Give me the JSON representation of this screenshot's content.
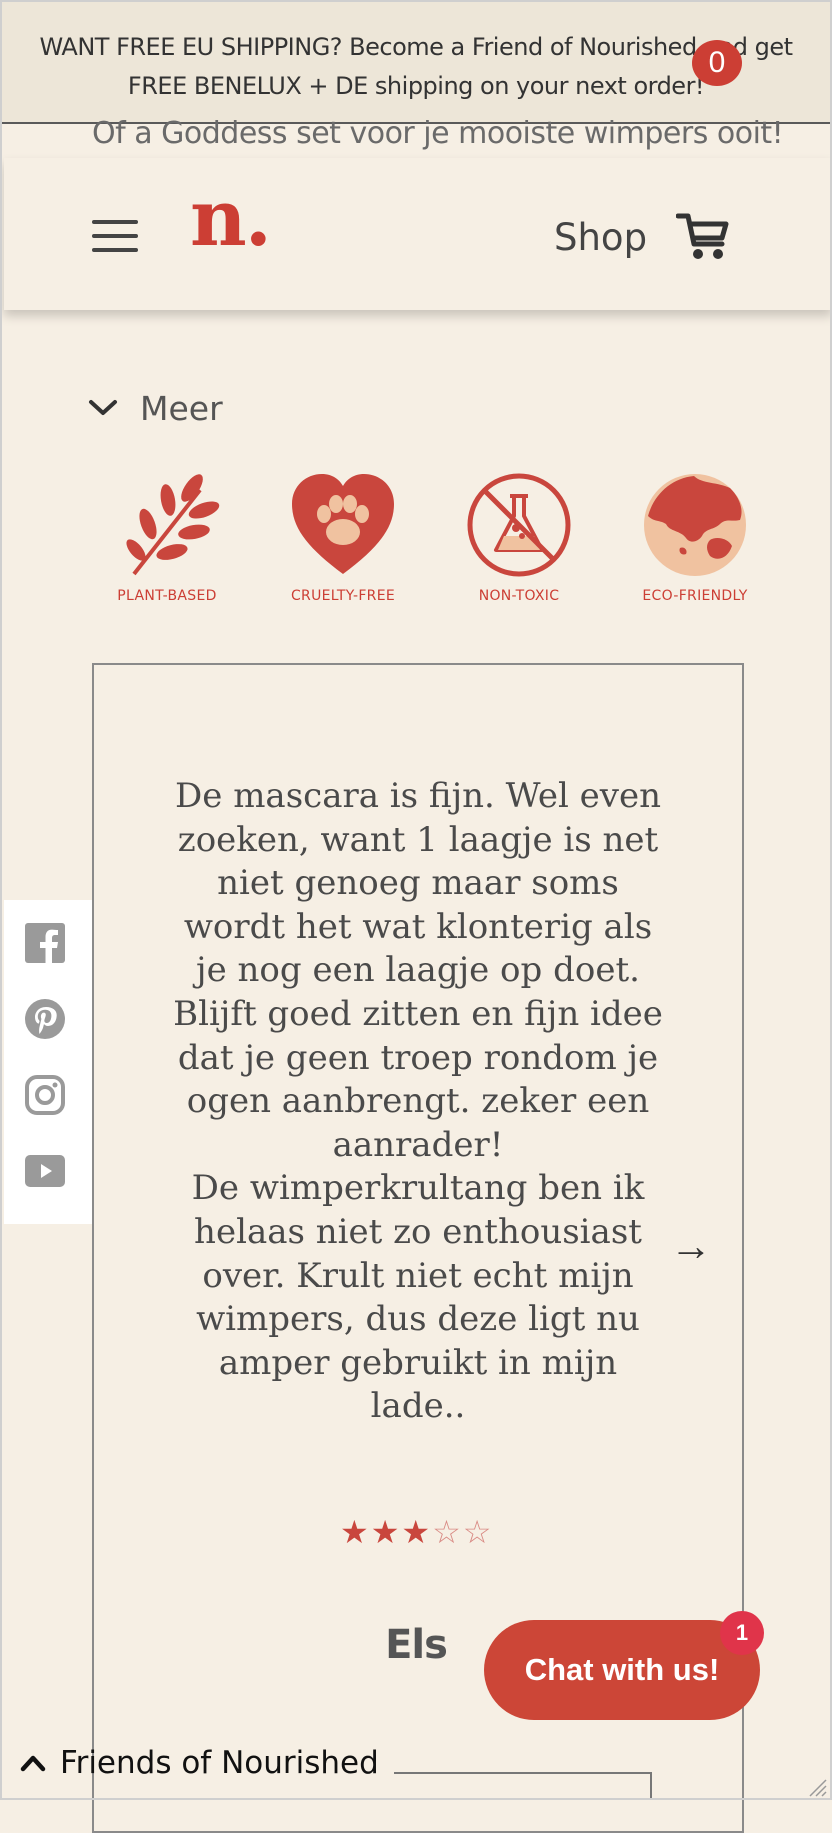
{
  "announcement": {
    "text": "WANT FREE EU SHIPPING? Become a Friend of Nourished and get FREE BENELUX + DE shipping on your next order!"
  },
  "behind_header_text": "Of a Goddess set voor je mooiste wimpers ooit!",
  "header": {
    "logo": "n.",
    "shop_label": "Shop",
    "cart_count": "0"
  },
  "meer": {
    "label": "Meer"
  },
  "badges": [
    {
      "label": "PLANT-BASED",
      "icon": "leaf-branch-icon"
    },
    {
      "label": "CRUELTY-FREE",
      "icon": "heart-paw-icon"
    },
    {
      "label": "NON-TOXIC",
      "icon": "no-flask-icon"
    },
    {
      "label": "ECO-FRIENDLY",
      "icon": "globe-icon"
    }
  ],
  "review": {
    "text": "De mascara is fijn. Wel even zoeken, want 1 laagje is net niet genoeg maar soms wordt het wat klonterig als je nog een laagje op doet. Blijft goed zitten en fijn idee dat je geen troep rondom je ogen aanbrengt. zeker een aanrader!\nDe wimperkrultang ben ik helaas niet zo enthousiast over. Krult niet echt mijn wimpers, dus deze ligt nu amper gebruikt in mijn lade..",
    "rating": 3,
    "rating_max": 5,
    "reviewer": "Els",
    "next_arrow": "→"
  },
  "social": [
    "facebook-icon",
    "pinterest-icon",
    "instagram-icon",
    "youtube-icon"
  ],
  "chat": {
    "label": "Chat with us!",
    "badge": "1"
  },
  "friends": {
    "label": "Friends of Nourished"
  },
  "colors": {
    "brand": "#cc3e34",
    "background": "#f6efe4",
    "announcement_bg": "#ede6d8",
    "peach": "#f0c2a0"
  }
}
